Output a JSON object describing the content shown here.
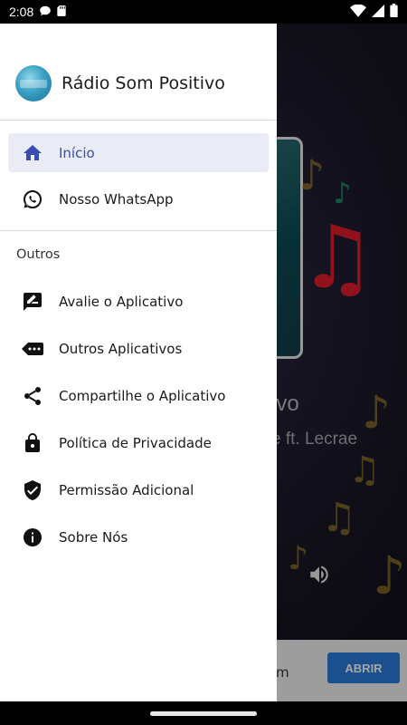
{
  "status_bar": {
    "time": "2:08"
  },
  "drawer": {
    "app_title": "Rádio Som Positivo",
    "primary_items": [
      {
        "label": "Início",
        "icon": "home-icon",
        "active": true
      },
      {
        "label": "Nosso WhatsApp",
        "icon": "whatsapp-icon",
        "active": false
      }
    ],
    "section_title": "Outros",
    "secondary_items": [
      {
        "label": "Avalie o Aplicativo",
        "icon": "rate-review-icon"
      },
      {
        "label": "Outros Aplicativos",
        "icon": "more-apps-icon"
      },
      {
        "label": "Compartilhe o Aplicativo",
        "icon": "share-icon"
      },
      {
        "label": "Política de Privacidade",
        "icon": "lock-icon"
      },
      {
        "label": "Permissão Adicional",
        "icon": "verified-shield-icon"
      },
      {
        "label": "Sobre Nós",
        "icon": "info-icon"
      }
    ]
  },
  "background_player": {
    "title_fragment": "ivo",
    "artist_fragment": "e ft. Lecrae",
    "ad_text_fragment": "m",
    "ad_button": "ABRIR"
  },
  "colors": {
    "accent": "#3b4cb3",
    "active_bg": "#e9ebf5",
    "ad_button": "#2a7ad9"
  }
}
